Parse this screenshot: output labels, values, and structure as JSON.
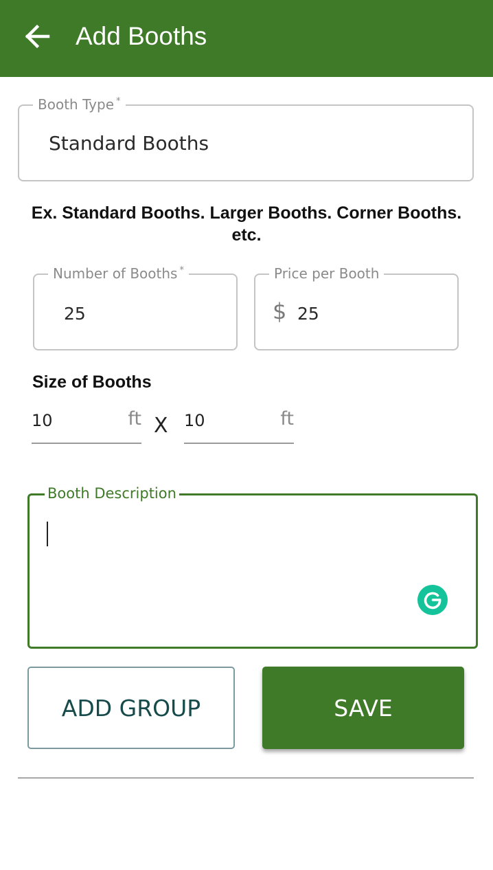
{
  "header": {
    "title": "Add Booths"
  },
  "booth_type": {
    "label": "Booth Type",
    "required_mark": "*",
    "value": "Standard Booths"
  },
  "hint": "Ex. Standard Booths. Larger Booths. Corner Booths. etc.",
  "number_of_booths": {
    "label": "Number of Booths",
    "required_mark": "*",
    "value": "25"
  },
  "price_per_booth": {
    "label": "Price per Booth",
    "currency": "$",
    "value": "25"
  },
  "size": {
    "heading": "Size of Booths",
    "width": "10",
    "length": "10",
    "unit": "ft",
    "separator": "X"
  },
  "description": {
    "label": "Booth Description",
    "value": ""
  },
  "buttons": {
    "add_group": "ADD GROUP",
    "save": "SAVE"
  },
  "colors": {
    "primary": "#3f7a28",
    "grammarly": "#15c39a"
  },
  "icons": {
    "back": "arrow-left-icon",
    "grammarly": "grammarly-icon"
  }
}
